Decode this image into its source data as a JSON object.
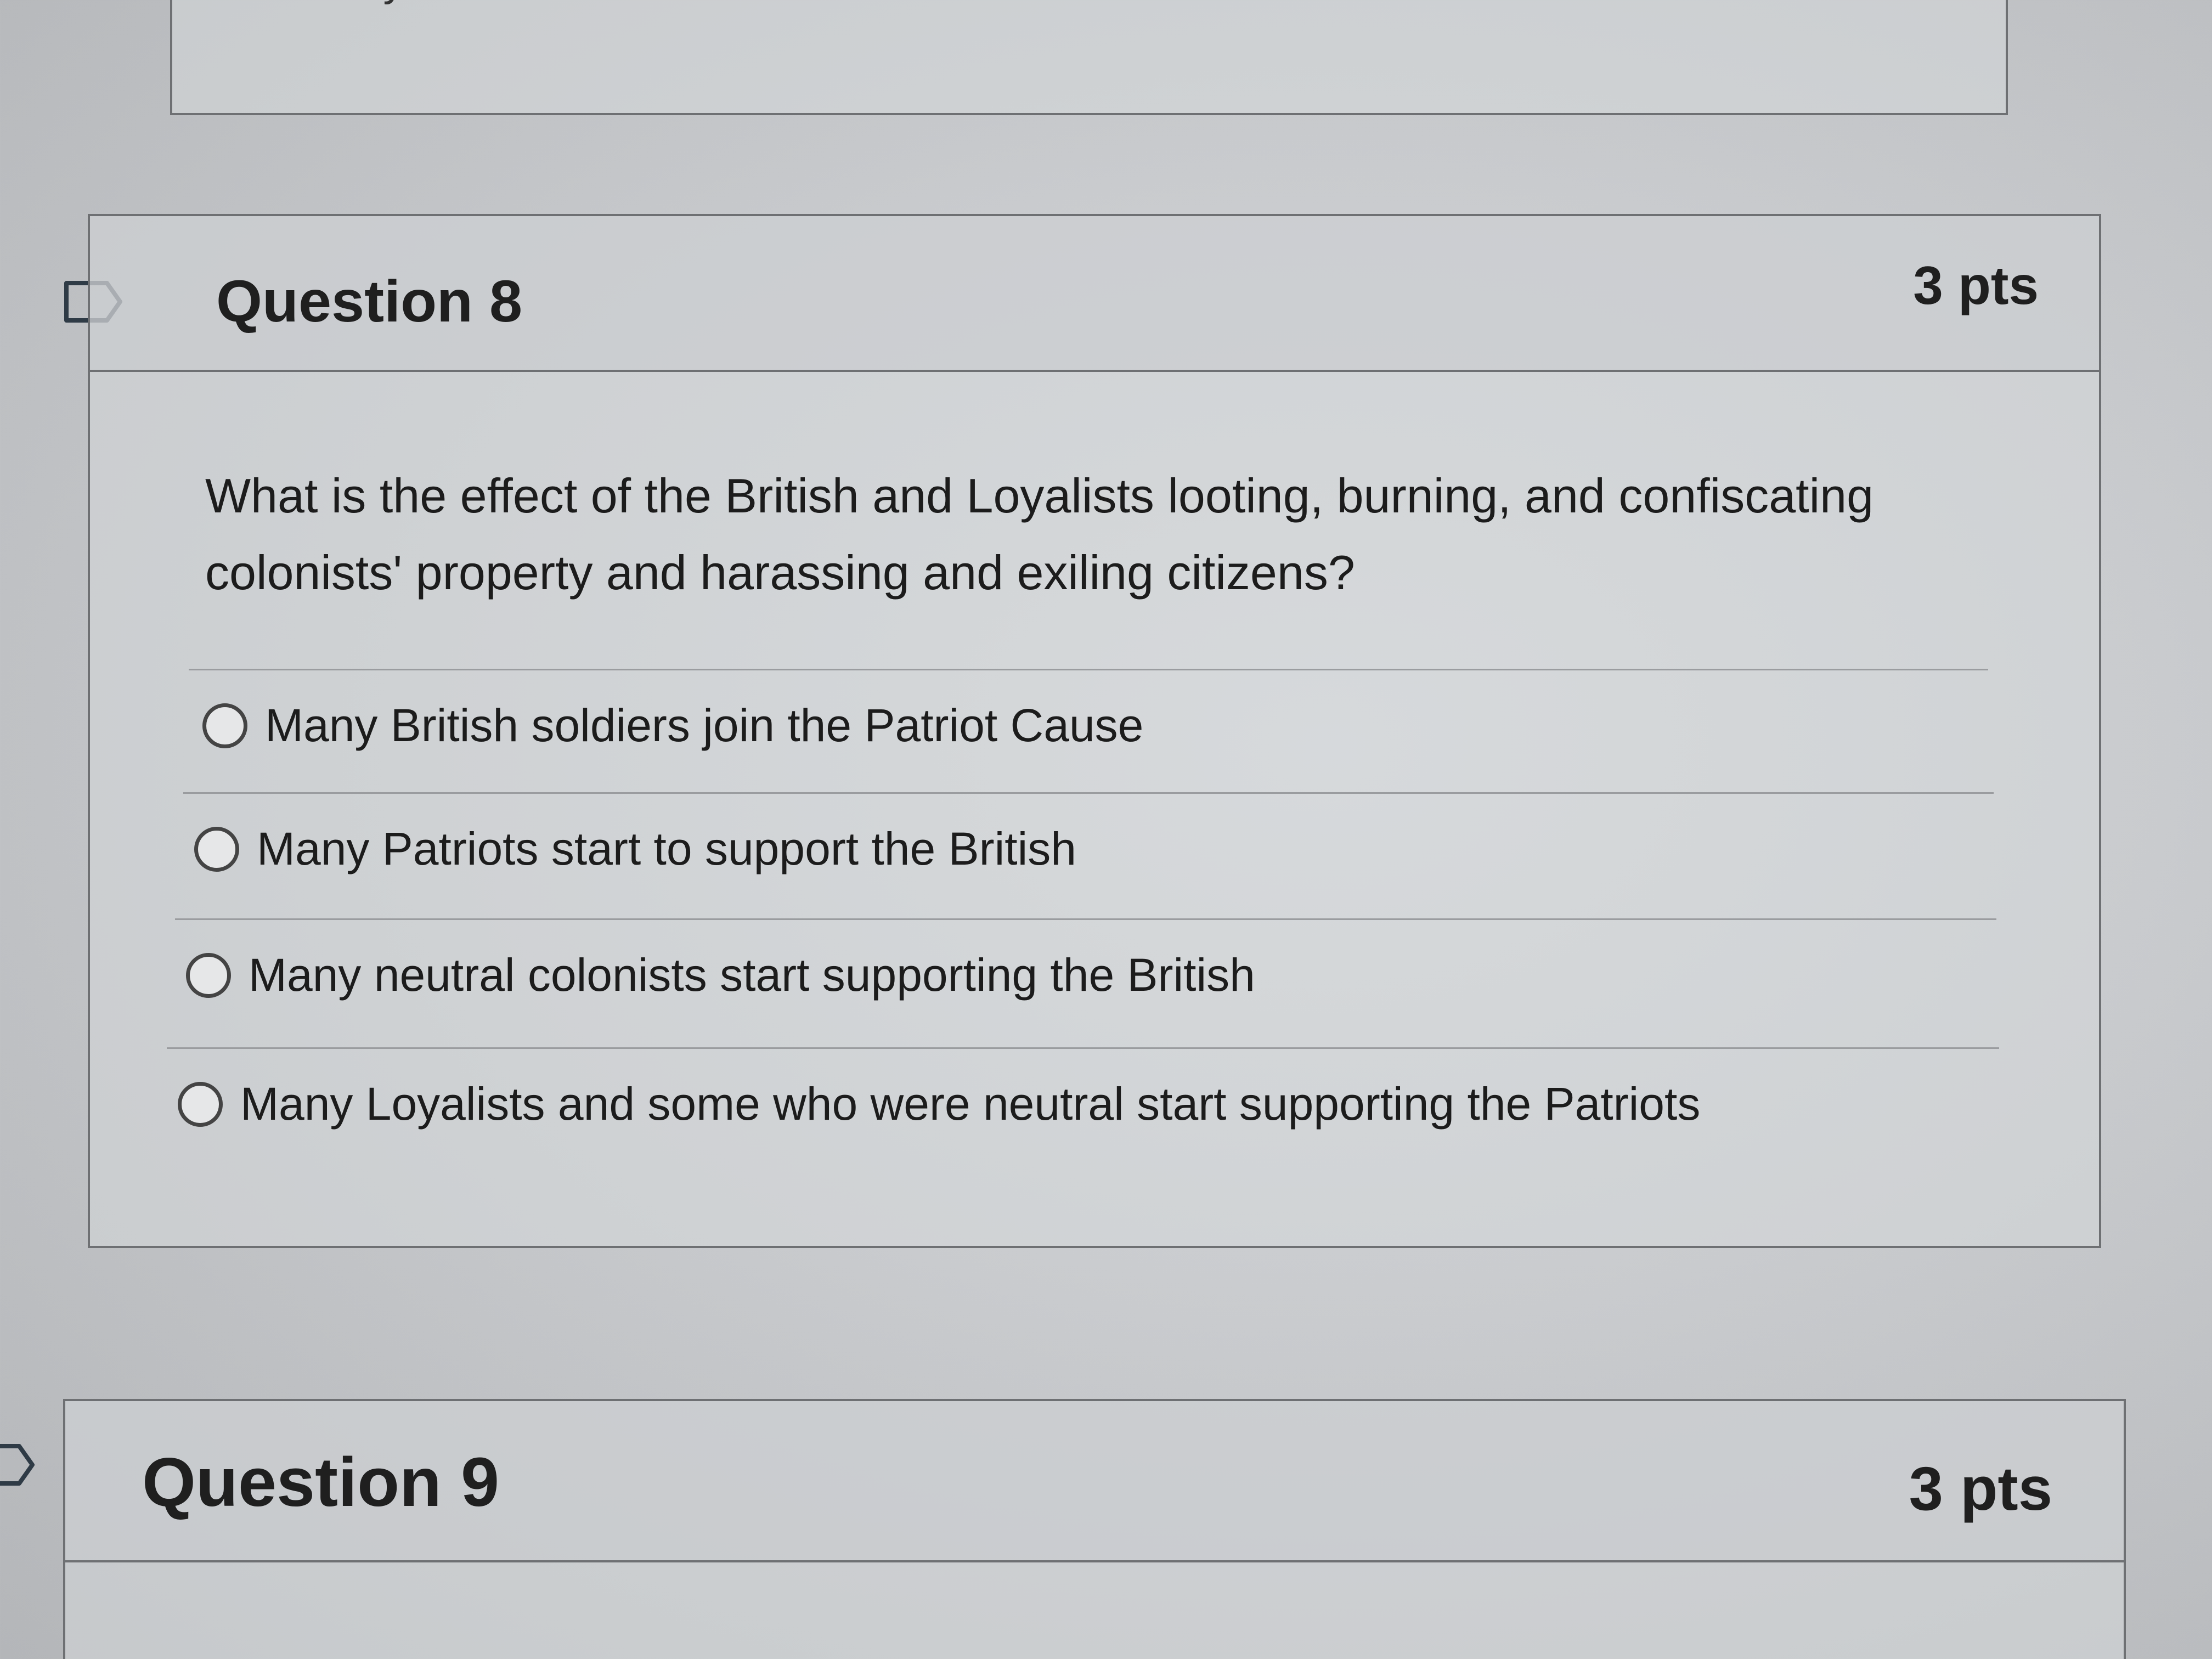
{
  "previous_question": {
    "partial_answer": "They attacked Sullivan's Island"
  },
  "question8": {
    "title": "Question 8",
    "points": "3 pts",
    "text": "What is the effect of the British and Loyalists looting, burning, and confiscating colonists' property and harassing and exiling citizens?",
    "answers": [
      "Many British soldiers join the Patriot Cause",
      "Many Patriots start to support the British",
      "Many neutral colonists start supporting the British",
      "Many Loyalists and some who were neutral start supporting the Patriots"
    ]
  },
  "question9": {
    "title": "Question 9",
    "points": "3 pts"
  }
}
